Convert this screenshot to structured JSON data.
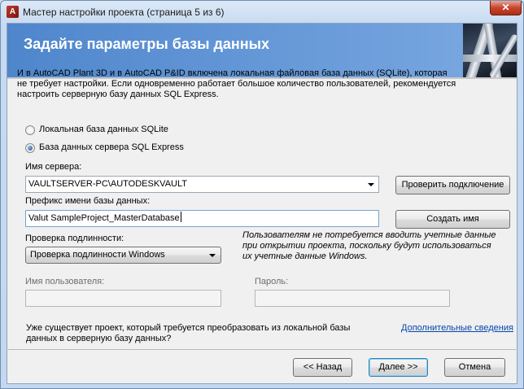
{
  "window": {
    "title": "Мастер настройки проекта (страница 5 из 6)",
    "app_icon_glyph": "A",
    "close_glyph": "✕"
  },
  "banner": {
    "title": "Задайте параметры базы данных",
    "image": "pipes-image"
  },
  "description": "И в AutoCAD Plant 3D и в AutoCAD P&ID включена локальная файловая база данных (SQLite), которая не требует настройки. Если одновременно работает большое количество пользователей, рекомендуется настроить серверную базу данных SQL Express.",
  "db_type": {
    "options": [
      {
        "label": "Локальная база данных SQLite",
        "selected": false
      },
      {
        "label": "База данных сервера SQL Express",
        "selected": true
      }
    ]
  },
  "server": {
    "label": "Имя сервера:",
    "value": "VAULTSERVER-PC\\AUTODESKVAULT",
    "check_button": "Проверить подключение"
  },
  "prefix": {
    "label": "Префикс имени базы данных:",
    "value": "Valut SampleProject_MasterDatabase",
    "create_button": "Создать имя"
  },
  "auth": {
    "label": "Проверка подлинности:",
    "value": "Проверка подлинности Windows",
    "note": "Пользователям не потребуется вводить учетные данные при открытии проекта, поскольку будут использоваться их учетные данные Windows."
  },
  "credentials": {
    "username_label": "Имя пользователя:",
    "username_value": "",
    "password_label": "Пароль:",
    "password_value": ""
  },
  "footer": {
    "question": "Уже существует проект, который требуется преобразовать из локальной базы данных в серверную базу данных?",
    "link": "Дополнительные сведения",
    "back_button": "<< Назад",
    "next_button": "Далее >>",
    "cancel_button": "Отмена"
  },
  "colors": {
    "banner": "#4f86cc",
    "link": "#0645ad",
    "close": "#c7452c"
  }
}
